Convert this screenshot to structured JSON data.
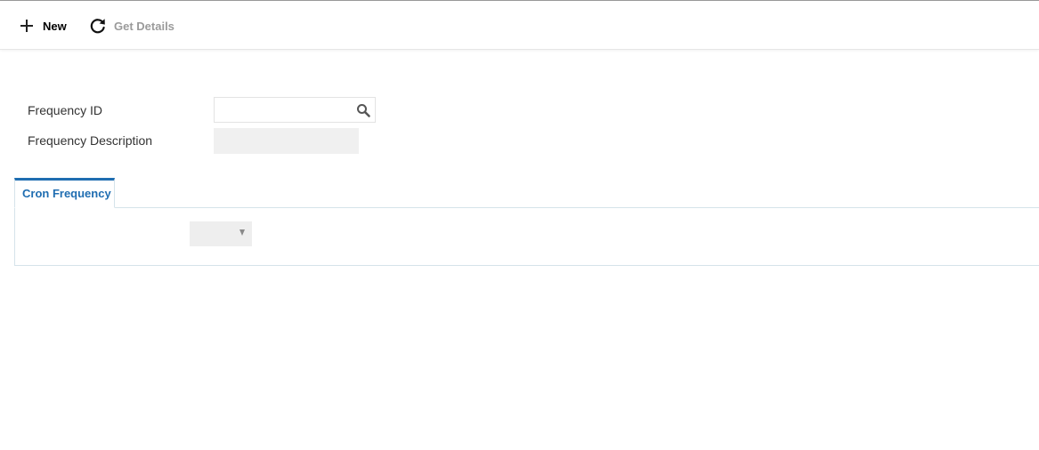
{
  "toolbar": {
    "new_label": "New",
    "new_icon": "plus-icon",
    "get_details_label": "Get Details",
    "get_details_icon": "refresh-icon"
  },
  "form": {
    "frequency_id": {
      "label": "Frequency ID",
      "value": "",
      "search_icon": "search-icon"
    },
    "frequency_description": {
      "label": "Frequency Description",
      "value": ""
    }
  },
  "tabs": [
    {
      "label": "Cron Frequency",
      "active": true
    }
  ],
  "cron_frequency": {
    "select_value": "",
    "dropdown_icon": "chevron-down-icon"
  },
  "colors": {
    "accent": "#1f6db1",
    "disabled_text": "#9b9b9b",
    "readonly_field": "#f0f0f0",
    "panel_border": "#d5e3ea"
  }
}
